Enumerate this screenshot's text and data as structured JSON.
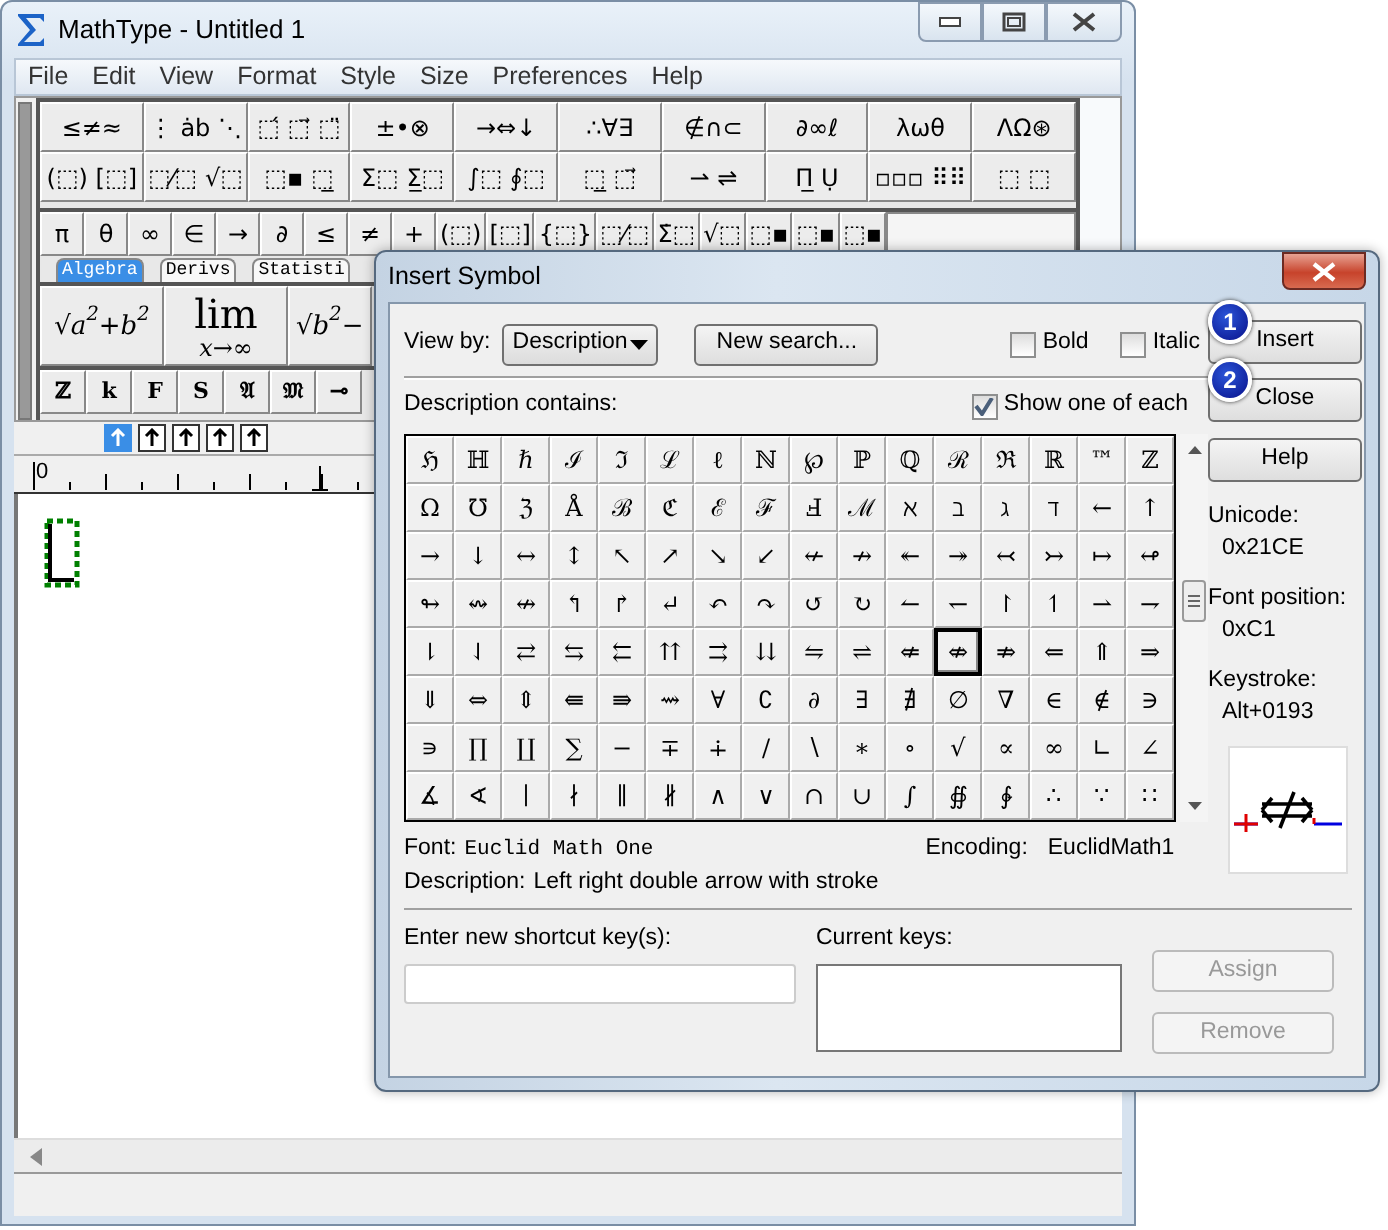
{
  "main_window": {
    "title": "MathType - Untitled 1",
    "menu": [
      "File",
      "Edit",
      "View",
      "Format",
      "Style",
      "Size",
      "Preferences",
      "Help"
    ],
    "palette_rows": [
      [
        "≤≠≈",
        "⋮ ȧb ⋱",
        "⬚́ ⬚⃗ ⬚̈",
        "±•⊗",
        "→⇔↓",
        "∴∀∃",
        "∉∩⊂",
        "∂∞ℓ",
        "λωθ",
        "ΛΩ⊛"
      ],
      [
        "(⬚) [⬚]",
        "⬚⁄⬚ √⬚",
        "⬚▪ ⬚̲",
        "Σ⬚ Σ̲⬚",
        "∫⬚ ∮⬚",
        "⬚̲ ⬚⃗",
        "⇀ ⇌",
        "Π̲ Ụ",
        "▫▫▫ ⠿⠿",
        "⬚ ⬚"
      ]
    ],
    "small_palette": [
      "π",
      "θ",
      "∞",
      "∈",
      "→",
      "∂",
      "≤",
      "≠",
      "+",
      "(⬚)",
      "[⬚]",
      "{⬚}",
      "⬚⁄⬚",
      "Σ̇⬚",
      "√⬚",
      "⬚▪",
      "⬚▪",
      "⬚▪"
    ],
    "template_tabs": [
      {
        "label": "Algebra",
        "selected": true
      },
      {
        "label": "Derivs",
        "selected": false
      },
      {
        "label": "Statisti",
        "selected": false
      }
    ],
    "templates": [
      {
        "kind": "text",
        "text": "√a$^{2}$+b$^{2}$"
      },
      {
        "kind": "limit",
        "top": "lim",
        "bottom": "x→∞"
      },
      {
        "kind": "text",
        "text": "√b$^{2}$−"
      }
    ],
    "bottom_palette": [
      "ℤ",
      "k",
      "F",
      "S",
      "𝔄",
      "𝔐",
      "⊸"
    ],
    "nudge_buttons": [
      {
        "selected": true
      },
      {
        "selected": false
      },
      {
        "selected": false
      },
      {
        "selected": false
      },
      {
        "selected": false
      }
    ],
    "ruler": {
      "label": "0"
    }
  },
  "dialog": {
    "title": "Insert Symbol",
    "view_by": {
      "label": "View by:",
      "value": "Description"
    },
    "new_search": "New search...",
    "style_options": [
      {
        "label": "Bold",
        "checked": false
      },
      {
        "label": "Italic",
        "checked": false
      }
    ],
    "description_label": "Description contains:",
    "show_one": {
      "label": "Show one of each",
      "checked": true
    },
    "buttons": [
      {
        "label": "Insert",
        "disabled": false
      },
      {
        "label": "Close",
        "disabled": false
      },
      {
        "label": "Help",
        "disabled": false
      }
    ],
    "callouts": [
      "1",
      "2"
    ],
    "symbol_rows": [
      [
        {
          "char": "ℌ",
          "selected": false
        },
        {
          "char": "ℍ",
          "selected": false
        },
        {
          "char": "ℏ",
          "selected": false
        },
        {
          "char": "ℐ",
          "selected": false
        },
        {
          "char": "ℑ",
          "selected": false
        },
        {
          "char": "ℒ",
          "selected": false
        },
        {
          "char": "ℓ",
          "selected": false
        },
        {
          "char": "ℕ",
          "selected": false
        },
        {
          "char": "℘",
          "selected": false
        },
        {
          "char": "ℙ",
          "selected": false
        },
        {
          "char": "ℚ",
          "selected": false
        },
        {
          "char": "ℛ",
          "selected": false
        },
        {
          "char": "ℜ",
          "selected": false
        },
        {
          "char": "ℝ",
          "selected": false
        },
        {
          "char": "™",
          "selected": false
        },
        {
          "char": "ℤ",
          "selected": false
        }
      ],
      [
        {
          "char": "Ω",
          "selected": false
        },
        {
          "char": "℧",
          "selected": false
        },
        {
          "char": "ℨ",
          "selected": false
        },
        {
          "char": "Å",
          "selected": false
        },
        {
          "char": "ℬ",
          "selected": false
        },
        {
          "char": "ℭ",
          "selected": false
        },
        {
          "char": "ℰ",
          "selected": false
        },
        {
          "char": "ℱ",
          "selected": false
        },
        {
          "char": "Ⅎ",
          "selected": false
        },
        {
          "char": "ℳ",
          "selected": false
        },
        {
          "char": "ℵ",
          "selected": false
        },
        {
          "char": "ℶ",
          "selected": false
        },
        {
          "char": "ℷ",
          "selected": false
        },
        {
          "char": "ℸ",
          "selected": false
        },
        {
          "char": "←",
          "selected": false
        },
        {
          "char": "↑",
          "selected": false
        }
      ],
      [
        {
          "char": "→",
          "selected": false
        },
        {
          "char": "↓",
          "selected": false
        },
        {
          "char": "↔",
          "selected": false
        },
        {
          "char": "↕",
          "selected": false
        },
        {
          "char": "↖",
          "selected": false
        },
        {
          "char": "↗",
          "selected": false
        },
        {
          "char": "↘",
          "selected": false
        },
        {
          "char": "↙",
          "selected": false
        },
        {
          "char": "↚",
          "selected": false
        },
        {
          "char": "↛",
          "selected": false
        },
        {
          "char": "↞",
          "selected": false
        },
        {
          "char": "↠",
          "selected": false
        },
        {
          "char": "↢",
          "selected": false
        },
        {
          "char": "↣",
          "selected": false
        },
        {
          "char": "↦",
          "selected": false
        },
        {
          "char": "↫",
          "selected": false
        }
      ],
      [
        {
          "char": "↬",
          "selected": false
        },
        {
          "char": "↭",
          "selected": false
        },
        {
          "char": "↮",
          "selected": false
        },
        {
          "char": "↰",
          "selected": false
        },
        {
          "char": "↱",
          "selected": false
        },
        {
          "char": "↵",
          "selected": false
        },
        {
          "char": "↶",
          "selected": false
        },
        {
          "char": "↷",
          "selected": false
        },
        {
          "char": "↺",
          "selected": false
        },
        {
          "char": "↻",
          "selected": false
        },
        {
          "char": "↼",
          "selected": false
        },
        {
          "char": "↽",
          "selected": false
        },
        {
          "char": "↾",
          "selected": false
        },
        {
          "char": "↿",
          "selected": false
        },
        {
          "char": "⇀",
          "selected": false
        },
        {
          "char": "⇁",
          "selected": false
        }
      ],
      [
        {
          "char": "⇂",
          "selected": false
        },
        {
          "char": "⇃",
          "selected": false
        },
        {
          "char": "⇄",
          "selected": false
        },
        {
          "char": "⇆",
          "selected": false
        },
        {
          "char": "⇇",
          "selected": false
        },
        {
          "char": "⇈",
          "selected": false
        },
        {
          "char": "⇉",
          "selected": false
        },
        {
          "char": "⇊",
          "selected": false
        },
        {
          "char": "⇋",
          "selected": false
        },
        {
          "char": "⇌",
          "selected": false
        },
        {
          "char": "⇍",
          "selected": false
        },
        {
          "char": "⇎",
          "selected": true
        },
        {
          "char": "⇏",
          "selected": false
        },
        {
          "char": "⇐",
          "selected": false
        },
        {
          "char": "⇑",
          "selected": false
        },
        {
          "char": "⇒",
          "selected": false
        }
      ],
      [
        {
          "char": "⇓",
          "selected": false
        },
        {
          "char": "⇔",
          "selected": false
        },
        {
          "char": "⇕",
          "selected": false
        },
        {
          "char": "⇚",
          "selected": false
        },
        {
          "char": "⇛",
          "selected": false
        },
        {
          "char": "⇝",
          "selected": false
        },
        {
          "char": "∀",
          "selected": false
        },
        {
          "char": "∁",
          "selected": false
        },
        {
          "char": "∂",
          "selected": false
        },
        {
          "char": "∃",
          "selected": false
        },
        {
          "char": "∄",
          "selected": false
        },
        {
          "char": "∅",
          "selected": false
        },
        {
          "char": "∇",
          "selected": false
        },
        {
          "char": "∈",
          "selected": false
        },
        {
          "char": "∉",
          "selected": false
        },
        {
          "char": "∋",
          "selected": false
        }
      ],
      [
        {
          "char": "∍",
          "selected": false
        },
        {
          "char": "∏",
          "selected": false
        },
        {
          "char": "∐",
          "selected": false
        },
        {
          "char": "∑",
          "selected": false
        },
        {
          "char": "−",
          "selected": false
        },
        {
          "char": "∓",
          "selected": false
        },
        {
          "char": "∔",
          "selected": false
        },
        {
          "char": "∕",
          "selected": false
        },
        {
          "char": "∖",
          "selected": false
        },
        {
          "char": "∗",
          "selected": false
        },
        {
          "char": "∘",
          "selected": false
        },
        {
          "char": "√",
          "selected": false
        },
        {
          "char": "∝",
          "selected": false
        },
        {
          "char": "∞",
          "selected": false
        },
        {
          "char": "∟",
          "selected": false
        },
        {
          "char": "∠",
          "selected": false
        }
      ],
      [
        {
          "char": "∡",
          "selected": false
        },
        {
          "char": "∢",
          "selected": false
        },
        {
          "char": "∣",
          "selected": false
        },
        {
          "char": "∤",
          "selected": false
        },
        {
          "char": "∥",
          "selected": false
        },
        {
          "char": "∦",
          "selected": false
        },
        {
          "char": "∧",
          "selected": false
        },
        {
          "char": "∨",
          "selected": false
        },
        {
          "char": "∩",
          "selected": false
        },
        {
          "char": "∪",
          "selected": false
        },
        {
          "char": "∫",
          "selected": false
        },
        {
          "char": "∯",
          "selected": false
        },
        {
          "char": "∲",
          "selected": false
        },
        {
          "char": "∴",
          "selected": false
        },
        {
          "char": "∵",
          "selected": false
        },
        {
          "char": "∷",
          "selected": false
        }
      ]
    ],
    "info": [
      {
        "label": "Unicode:",
        "value": "0x21CE"
      },
      {
        "label": "Font position:",
        "value": "0xC1"
      },
      {
        "label": "Keystroke:",
        "value": "Alt+0193"
      }
    ],
    "font": {
      "label": "Font:",
      "value": "Euclid Math One"
    },
    "encoding": {
      "label": "Encoding:",
      "value": "EuclidMath1"
    },
    "description": {
      "label": "Description:",
      "value": "Left right double arrow with stroke"
    },
    "shortcut": {
      "label": "Enter new shortcut key(s):"
    },
    "current_keys": {
      "label": "Current keys:"
    },
    "key_buttons": [
      {
        "label": "Assign",
        "disabled": true
      },
      {
        "label": "Remove",
        "disabled": true
      }
    ]
  }
}
